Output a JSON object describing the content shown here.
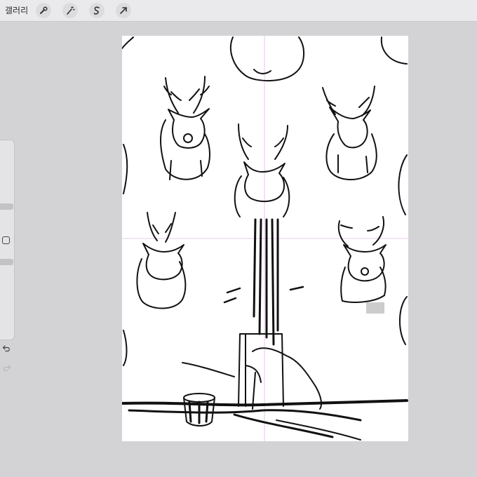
{
  "toolbar": {
    "gallery_label": "갤러리",
    "tools": [
      "wrench-icon",
      "magic-wand-icon",
      "selection-icon",
      "transform-arrow-icon"
    ]
  },
  "sidebar": {
    "sliders": [
      "brush-size",
      "opacity"
    ],
    "modify_button": "square-icon",
    "undo": "undo-icon",
    "redo": "redo-icon"
  },
  "canvas": {
    "background": "#ffffff",
    "guide_color": "#e4b8ea",
    "ink_color": "#111111"
  }
}
